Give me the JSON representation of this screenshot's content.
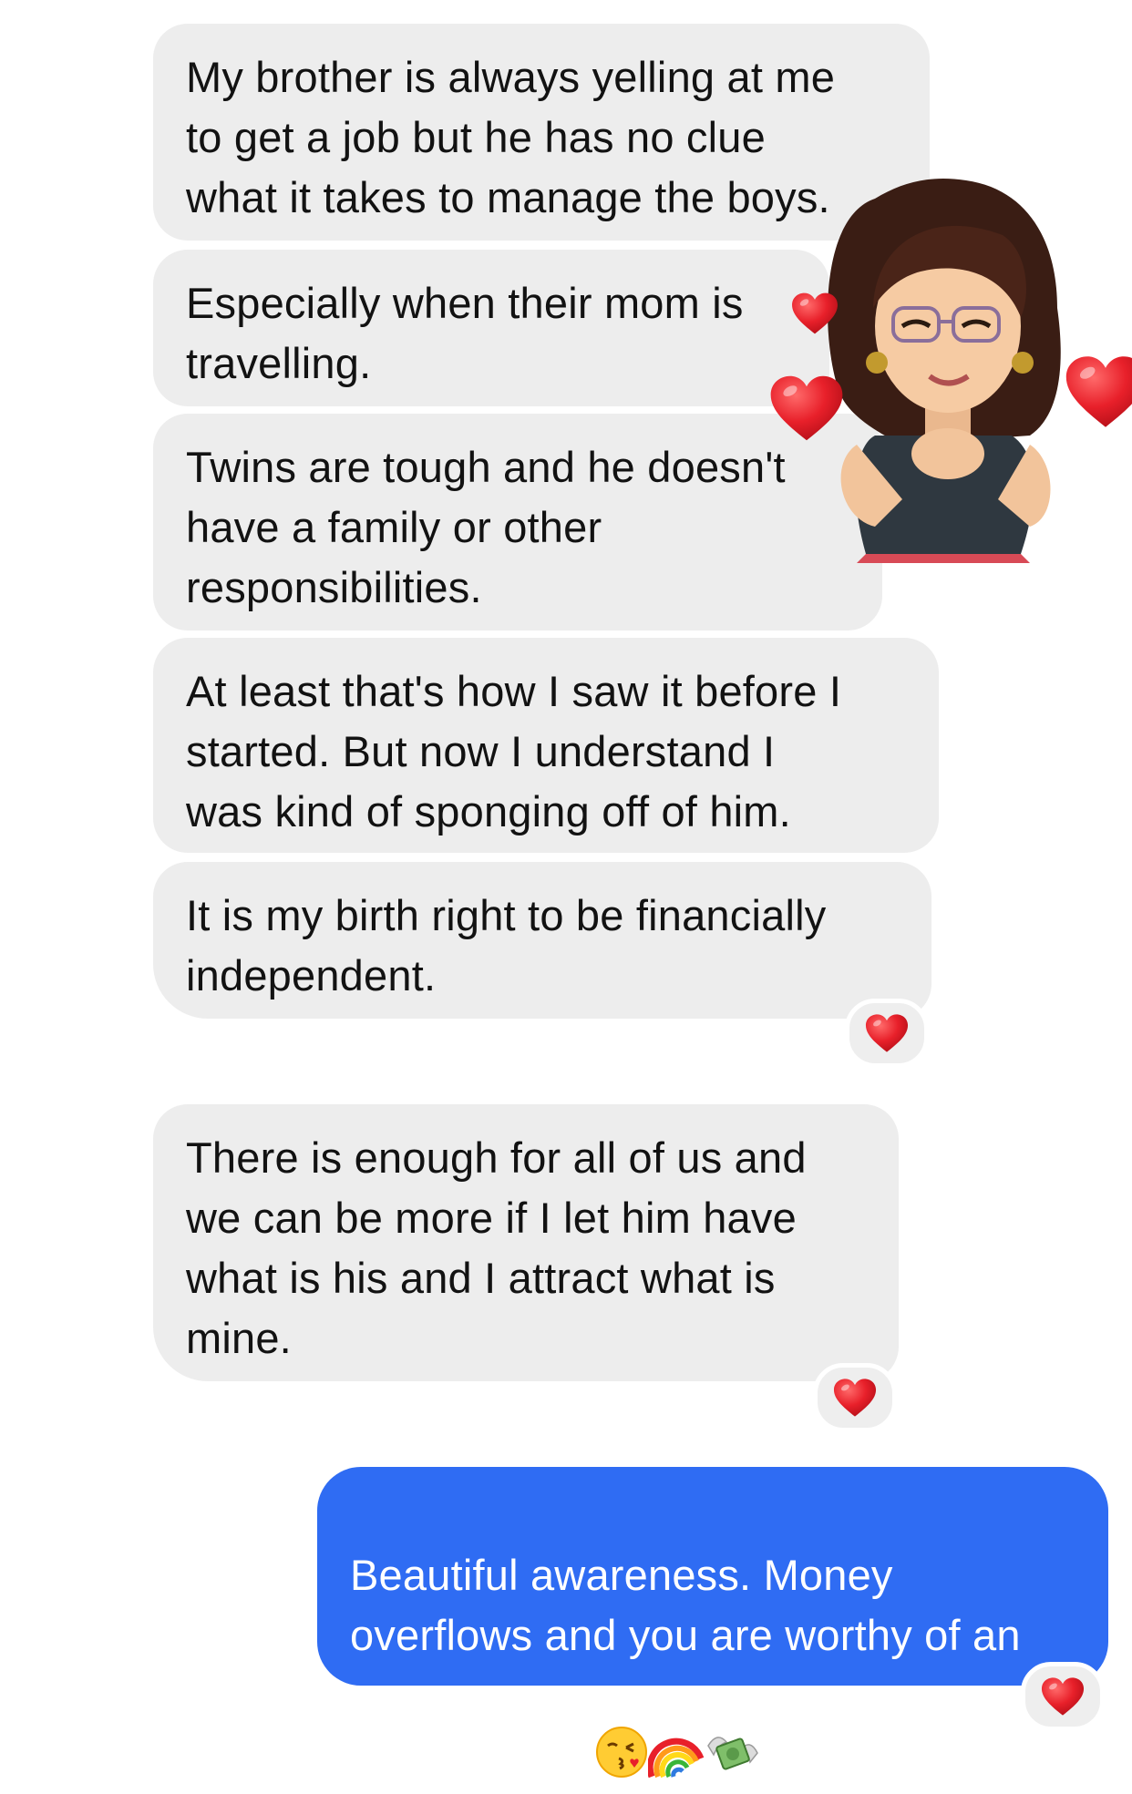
{
  "messages": [
    {
      "id": "m1",
      "sender": "them",
      "text": "My brother is always yelling at me\nto get a job but he has no clue\nwhat it takes to manage the boys."
    },
    {
      "id": "m2",
      "sender": "them",
      "text": "Especially when their mom is\ntravelling."
    },
    {
      "id": "m3",
      "sender": "them",
      "text": "Twins are tough and he doesn't\nhave a family or other\nresponsibilities."
    },
    {
      "id": "m4",
      "sender": "them",
      "text": "At least that's how I saw it before I\nstarted. But now I understand I\nwas kind of sponging off of him."
    },
    {
      "id": "m5",
      "sender": "them",
      "text": "It is my birth right to be financially\nindependent.",
      "reaction": "heart-icon"
    },
    {
      "id": "m6",
      "sender": "them",
      "text": "There is enough for all of us and\nwe can be more if I let him have\nwhat is his and I attract what is\nmine.",
      "reaction": "heart-icon"
    },
    {
      "id": "m7",
      "sender": "me",
      "text": "Beautiful awareness. Money\noverflows and you are worthy of an\noverflow too ",
      "emojis": [
        "kissing-face-icon",
        "rainbow-icon",
        "money-with-wings-icon"
      ],
      "reaction": "heart-icon"
    }
  ],
  "sticker": {
    "name": "memoji-woman-with-hearts-sticker"
  },
  "colors": {
    "incoming_bubble": "#ededed",
    "outgoing_bubble": "#2f6cf3",
    "heart": "#e8202a"
  }
}
